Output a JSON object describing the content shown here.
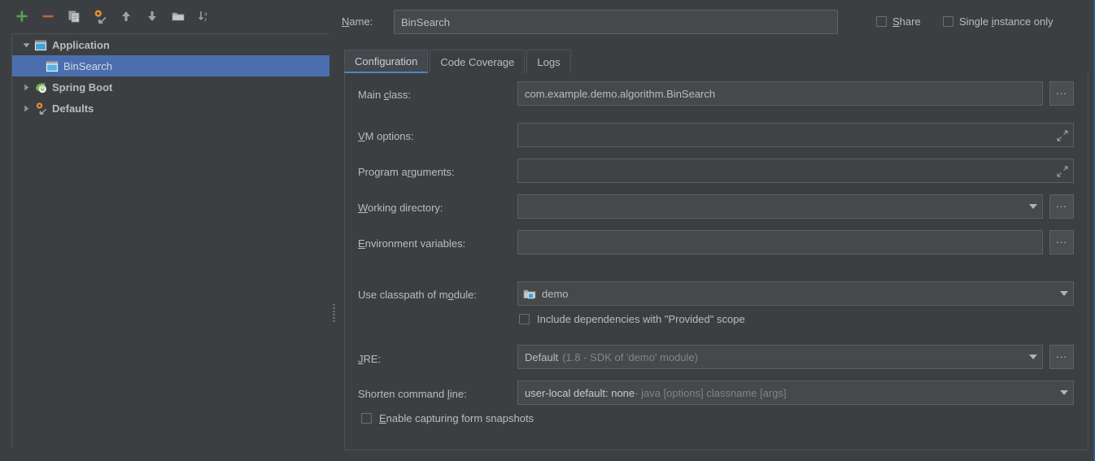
{
  "window": {
    "focus_border_color": "#2d5a86",
    "bg": "#3c3f41",
    "selection_color": "#4b6eaf",
    "accent": "#4a88c7"
  },
  "toolbar": {
    "buttons": [
      {
        "name": "add-configuration-button",
        "icon": "plus-icon",
        "tooltip": "Add New Configuration"
      },
      {
        "name": "remove-configuration-button",
        "icon": "minus-icon",
        "tooltip": "Remove Configuration"
      },
      {
        "name": "copy-configuration-button",
        "icon": "copy-icon",
        "tooltip": "Copy Configuration"
      },
      {
        "name": "edit-defaults-button",
        "icon": "wrench-gear-icon",
        "tooltip": "Edit defaults"
      },
      {
        "name": "move-up-button",
        "icon": "arrow-up-icon",
        "tooltip": "Move Up"
      },
      {
        "name": "move-down-button",
        "icon": "arrow-down-icon",
        "tooltip": "Move Down"
      },
      {
        "name": "create-folder-button",
        "icon": "folder-icon",
        "tooltip": "Create New Folder"
      },
      {
        "name": "sort-configurations-button",
        "icon": "sort-az-icon",
        "tooltip": "Sort Configurations"
      }
    ]
  },
  "tree": {
    "nodes": [
      {
        "label": "Application",
        "icon": "application-icon",
        "twisty": "expanded",
        "level": 0,
        "selected": false
      },
      {
        "label": "BinSearch",
        "icon": "application-icon",
        "twisty": "none",
        "level": 1,
        "selected": true
      },
      {
        "label": "Spring Boot",
        "icon": "spring-boot-icon",
        "twisty": "collapsed",
        "level": 0,
        "selected": false
      },
      {
        "label": "Defaults",
        "icon": "wrench-gear-icon",
        "twisty": "collapsed",
        "level": 0,
        "selected": false
      }
    ]
  },
  "header": {
    "name_label": "Name:",
    "name_value": "BinSearch",
    "share": {
      "label": "Share",
      "checked": false
    },
    "single_instance": {
      "label": "Single instance only",
      "checked": false
    }
  },
  "tabs": [
    {
      "label": "Configuration",
      "active": true
    },
    {
      "label": "Code Coverage",
      "active": false
    },
    {
      "label": "Logs",
      "active": false
    }
  ],
  "form": {
    "main_class": {
      "label": "Main class:",
      "value": "com.example.demo.algorithm.BinSearch",
      "browse": "..."
    },
    "vm_options": {
      "label": "VM options:",
      "value": "",
      "expand_icon": "expand-arrows-icon"
    },
    "program_arguments": {
      "label": "Program arguments:",
      "value": "",
      "expand_icon": "expand-arrows-icon"
    },
    "working_directory": {
      "label": "Working directory:",
      "value": "",
      "browse": "..."
    },
    "environment_variables": {
      "label": "Environment variables:",
      "value": "",
      "browse": "..."
    },
    "use_classpath_of_module": {
      "label": "Use classpath of module:",
      "value": "demo",
      "icon": "module-icon"
    },
    "include_provided": {
      "label": "Include dependencies with \"Provided\" scope",
      "checked": false
    },
    "jre": {
      "label": "JRE:",
      "value": "Default",
      "value_hint": "(1.8 - SDK of 'demo' module)",
      "browse": "..."
    },
    "shorten_command_line": {
      "label": "Shorten command line:",
      "value_strong": "user-local default: none",
      "value_rest": " - java [options] classname [args]"
    },
    "enable_form_snapshots": {
      "label": "Enable capturing form snapshots",
      "checked": false
    }
  }
}
